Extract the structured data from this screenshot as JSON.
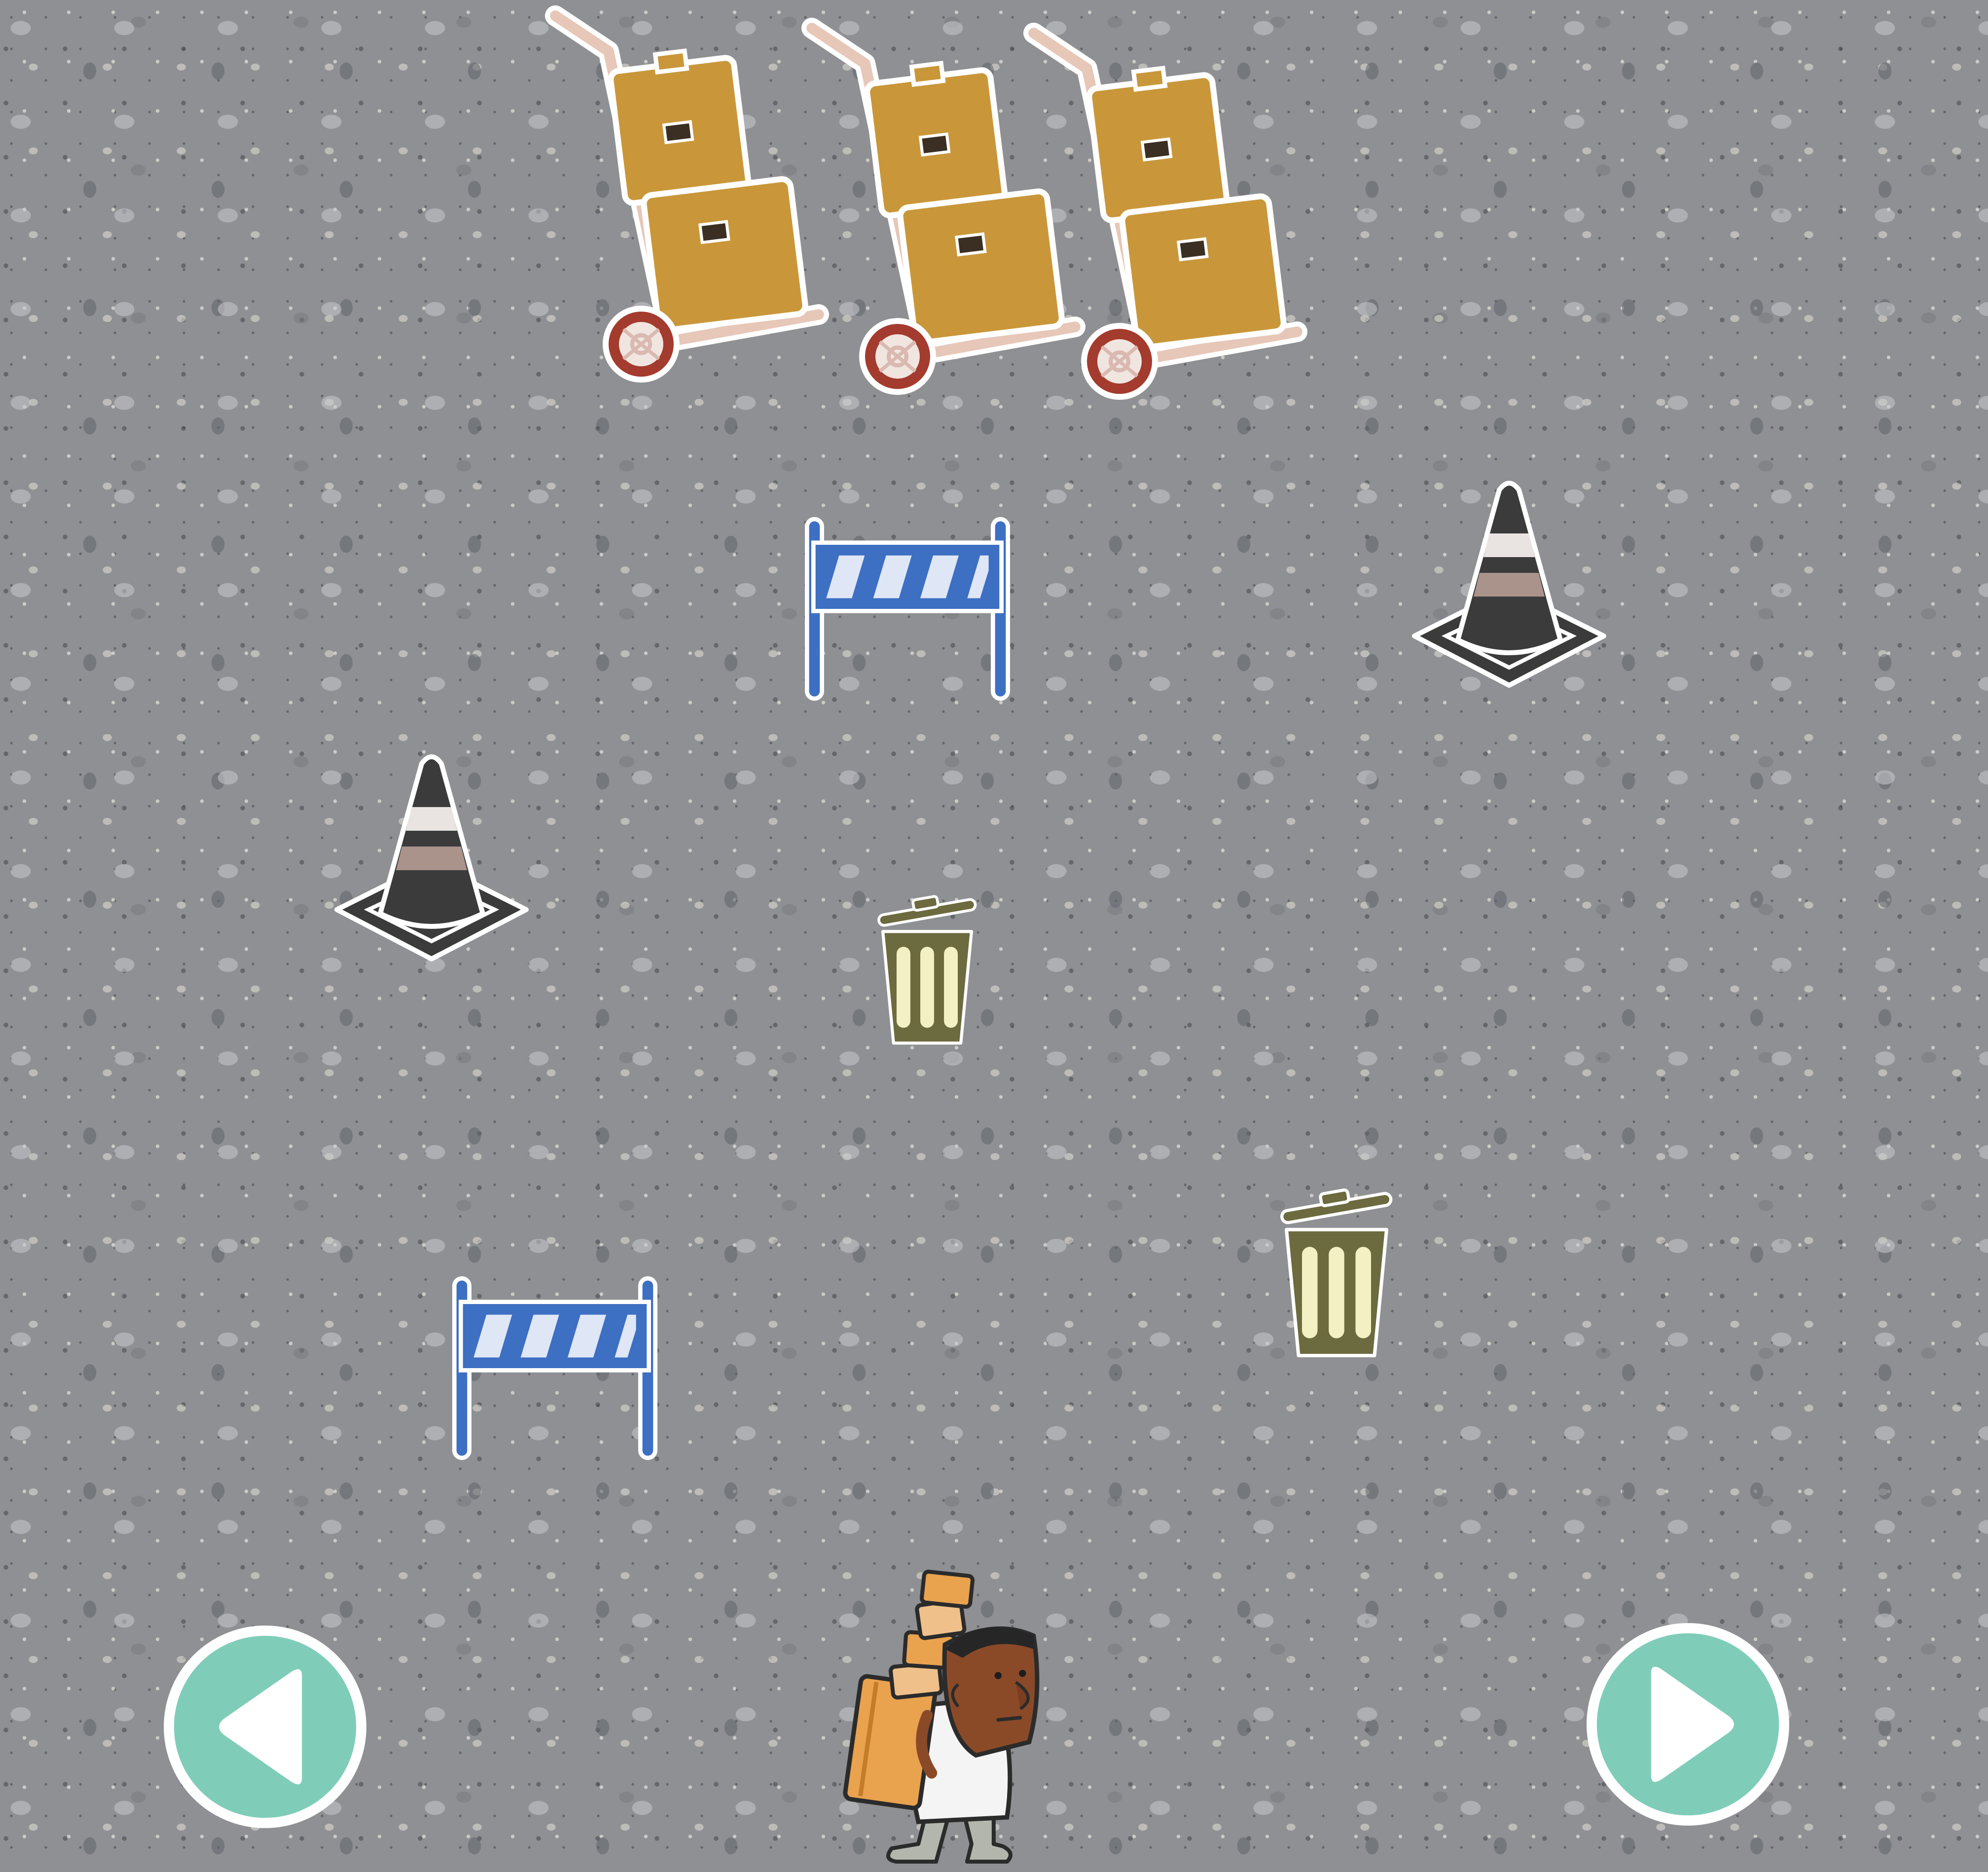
{
  "game": {
    "scene": "street",
    "background": "gravel-asphalt",
    "player": {
      "name": "delivery-worker",
      "icon": "man-carrying-boxes-icon"
    },
    "obstacles": [
      {
        "type": "hand-truck",
        "icon": "hand-truck-with-boxes-icon"
      },
      {
        "type": "hand-truck",
        "icon": "hand-truck-with-boxes-icon"
      },
      {
        "type": "hand-truck",
        "icon": "hand-truck-with-boxes-icon"
      },
      {
        "type": "barrier",
        "icon": "road-barrier-icon"
      },
      {
        "type": "traffic-cone",
        "icon": "traffic-cone-icon"
      },
      {
        "type": "traffic-cone",
        "icon": "traffic-cone-icon"
      },
      {
        "type": "trash-can",
        "icon": "trash-can-icon"
      },
      {
        "type": "trash-can",
        "icon": "trash-can-icon"
      },
      {
        "type": "barrier",
        "icon": "road-barrier-icon"
      }
    ]
  },
  "controls": {
    "left": {
      "icon": "left-arrow-icon"
    },
    "right": {
      "icon": "right-arrow-icon"
    }
  },
  "colors": {
    "button_fill": "#7fcdb8",
    "box_fill": "#c9973a",
    "cart_frame": "#e6c7b8",
    "wheel_rim": "#a33b2e",
    "barrier_blue": "#3d6fc2",
    "barrier_stripe": "#dfe6f5",
    "cone_dark": "#3b3b3c",
    "cone_band": "#a9938a",
    "trash_olive": "#6c6a3f",
    "trash_light": "#f3f1c4",
    "skin": "#8a4a28",
    "shirt": "#f4f4f4",
    "pants": "#b3b6ad"
  }
}
